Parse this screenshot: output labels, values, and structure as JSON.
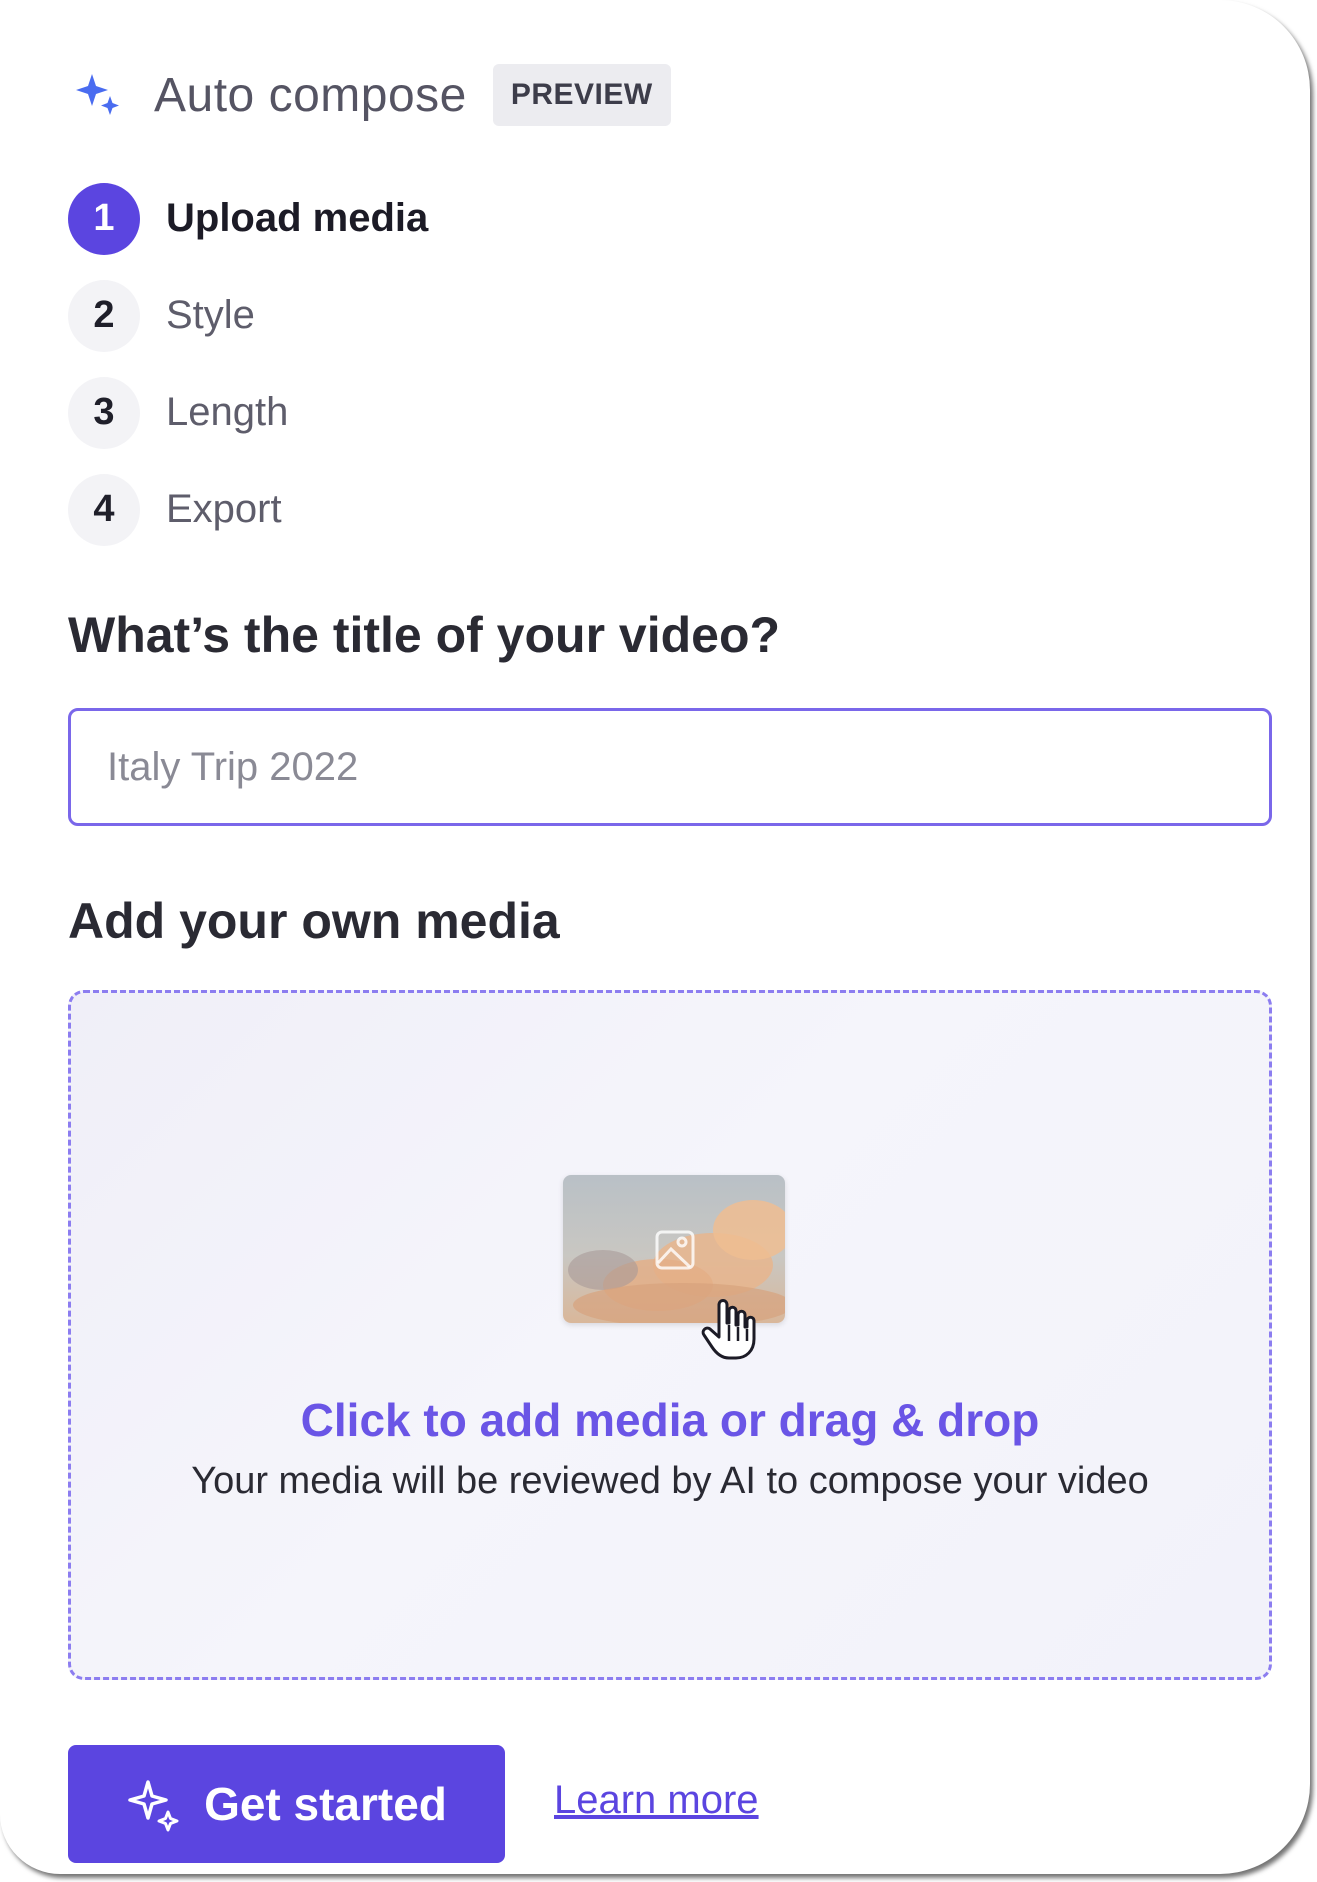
{
  "header": {
    "title": "Auto compose",
    "badge": "PREVIEW",
    "logo_icon": "sparkle-icon",
    "accent_color": "#4a6cf0"
  },
  "steps": [
    {
      "number": "1",
      "label": "Upload media",
      "active": true
    },
    {
      "number": "2",
      "label": "Style",
      "active": false
    },
    {
      "number": "3",
      "label": "Length",
      "active": false
    },
    {
      "number": "4",
      "label": "Export",
      "active": false
    }
  ],
  "title_section": {
    "heading": "What’s the title of your video?",
    "input_placeholder": "Italy Trip 2022",
    "input_value": ""
  },
  "media_section": {
    "heading": "Add your own media",
    "drop_primary": "Click to add media or drag & drop",
    "drop_secondary": "Your media will be reviewed by AI to compose your video",
    "thumbnail_icon": "image-icon",
    "cursor_icon": "hand-cursor-icon"
  },
  "actions": {
    "primary_label": "Get started",
    "primary_icon": "sparkle-icon",
    "link_label": "Learn more"
  },
  "colors": {
    "primary": "#5b45e0",
    "input_border": "#7a67ea",
    "dropzone_border": "#8c7df0"
  }
}
